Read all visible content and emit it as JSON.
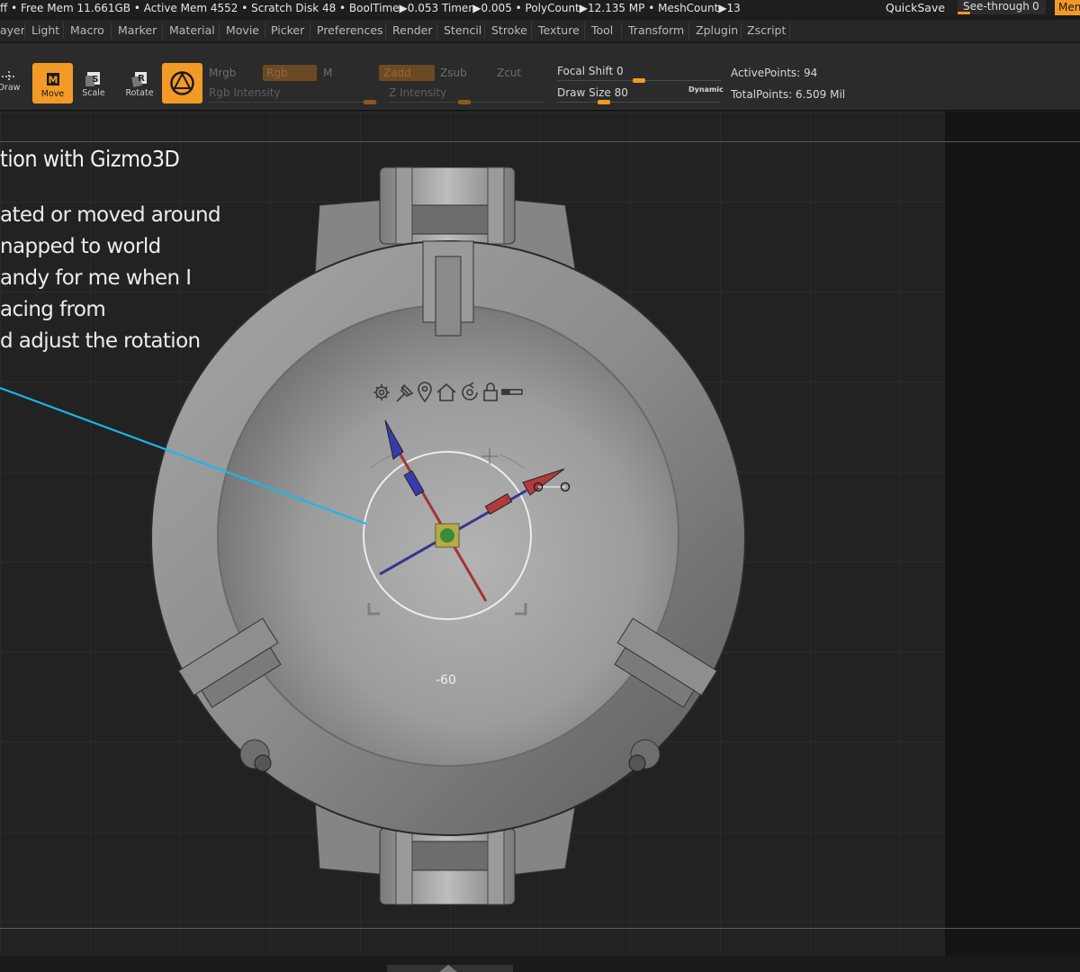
{
  "status_bar": {
    "text": "ff   • Free Mem 11.661GB • Active Mem 4552 • Scratch Disk 48 •  BoolTime▶0.053 Timer▶0.005 • PolyCount▶12.135 MP  • MeshCount▶13",
    "quicksave": "QuickSave",
    "see_through_label": "See-through",
    "see_through_value": "0",
    "see_through_fraction": 0,
    "menus_button": "Menu",
    "accent": "#f39a26"
  },
  "menu_bar": {
    "items": [
      "ayer",
      "Light",
      "Macro",
      "Marker",
      "Material",
      "Movie",
      "Picker",
      "Preferences",
      "Render",
      "Stencil",
      "Stroke",
      "Texture",
      "Tool",
      "Transform",
      "Zplugin",
      "Zscript"
    ]
  },
  "toolbar": {
    "draw_label": "Draw",
    "move_label": "Move",
    "scale_label": "Scale",
    "rotate_label": "Rotate",
    "gizmo_icon": "gizmo3d-icon",
    "mrgb": "Mrgb",
    "rgb": "Rgb",
    "m": "M",
    "zadd": "Zadd",
    "zsub": "Zsub",
    "zcut": "Zcut",
    "rgb_intensity": "Rgb Intensity",
    "z_intensity": "Z Intensity",
    "focal_shift": "Focal Shift 0",
    "draw_size": "Draw Size 80",
    "dynamic": "Dynamic",
    "active_points": "ActivePoints: 94",
    "total_points": "TotalPoints: 6.509 Mil"
  },
  "overlay": {
    "title": "tion with Gizmo3D",
    "lines": [
      "ated or moved around",
      "napped to world",
      "andy for me when I",
      "acing from",
      "d adjust the rotation"
    ],
    "callout_color": "#19b8ee"
  },
  "viewport": {
    "angle_readout": "-60",
    "gizmo_icons": [
      "gear-icon",
      "pin-icon",
      "location-icon",
      "home-icon",
      "reset-icon",
      "lock-icon",
      "slider-icon"
    ]
  }
}
